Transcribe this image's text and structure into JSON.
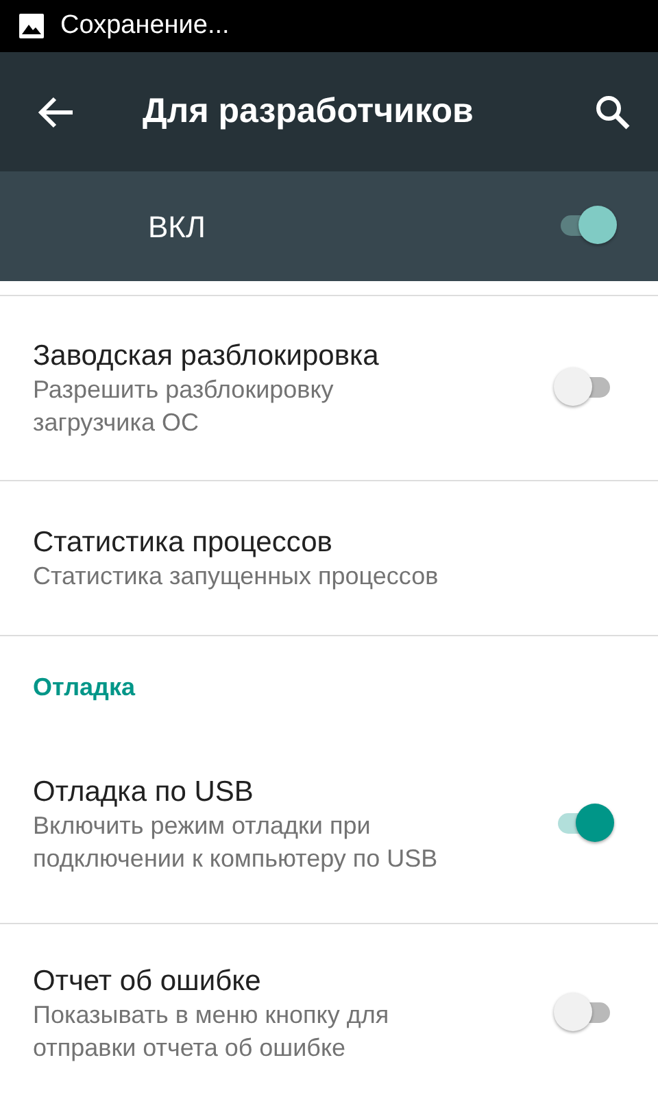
{
  "status_bar": {
    "text": "Сохранение..."
  },
  "toolbar": {
    "title": "Для разработчиков"
  },
  "master_switch": {
    "label": "ВКЛ",
    "on": true
  },
  "items": [
    {
      "kind": "switch",
      "title": "Заводская разблокировка",
      "subtitle": "Разрешить разблокировку загрузчика ОС",
      "on": false
    },
    {
      "kind": "plain",
      "title": "Статистика процессов",
      "subtitle": "Статистика запущенных процессов"
    },
    {
      "kind": "header",
      "title": "Отладка"
    },
    {
      "kind": "switch",
      "title": "Отладка по USB",
      "subtitle": "Включить режим отладки при подключении к компьютеру по USB",
      "on": true
    },
    {
      "kind": "switch",
      "title": "Отчет об ошибке",
      "subtitle": "Показывать в меню кнопку для отправки отчета об ошибке",
      "on": false
    }
  ]
}
